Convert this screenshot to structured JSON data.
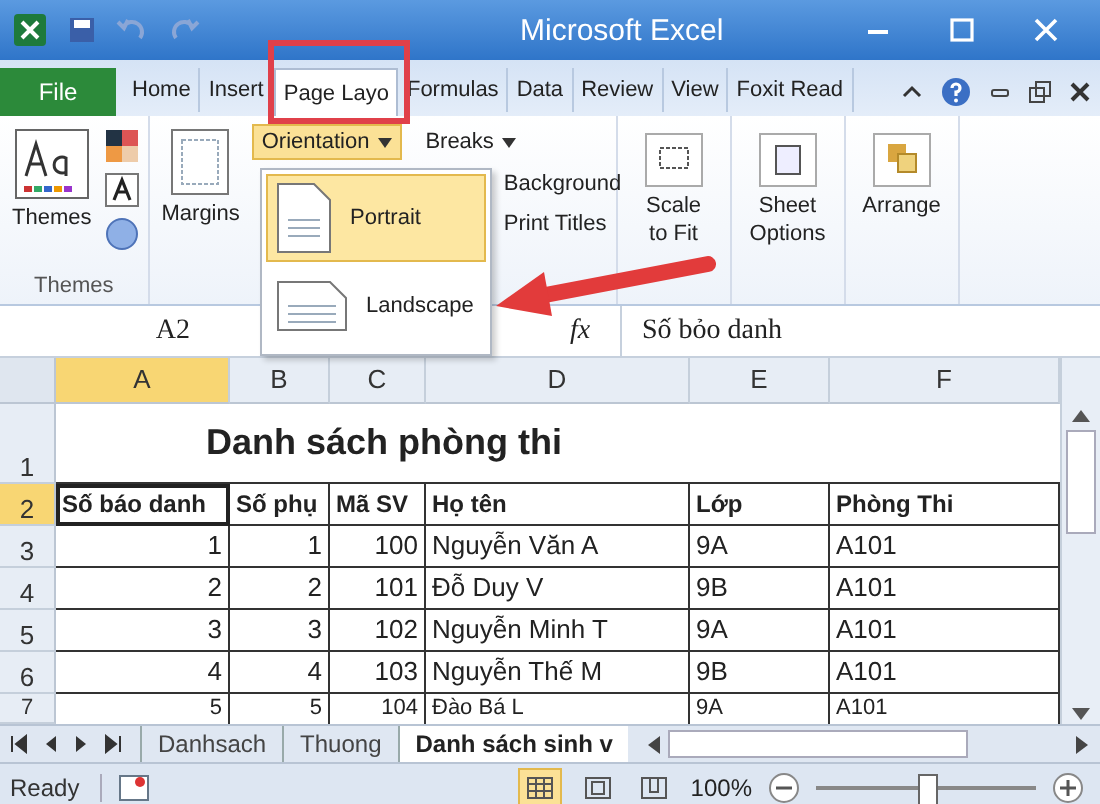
{
  "window": {
    "title": "Microsoft Excel"
  },
  "ribbon_tabs": [
    {
      "label": "File",
      "kind": "file",
      "selected": false
    },
    {
      "label": "Home",
      "kind": "tab",
      "selected": false
    },
    {
      "label": "Insert",
      "kind": "tab",
      "selected": false
    },
    {
      "label": "Page Layo",
      "kind": "tab",
      "selected": true
    },
    {
      "label": "Formulas",
      "kind": "tab",
      "selected": false
    },
    {
      "label": "Data",
      "kind": "tab",
      "selected": false
    },
    {
      "label": "Review",
      "kind": "tab",
      "selected": false
    },
    {
      "label": "View",
      "kind": "tab",
      "selected": false
    },
    {
      "label": "Foxit Read",
      "kind": "tab",
      "selected": false
    }
  ],
  "ribbon": {
    "themes": "Themes",
    "themes_group_label": "Themes",
    "margins": "Margins",
    "orientation": "Orientation",
    "breaks": "Breaks",
    "background": "Background",
    "print_titles": "Print Titles",
    "scale_to_fit": [
      "Scale",
      "to Fit"
    ],
    "sheet_options": [
      "Sheet",
      "Options"
    ],
    "arrange": "Arrange"
  },
  "orientation_menu": [
    {
      "label": "Portrait",
      "kind": "portrait",
      "selected": true
    },
    {
      "label": "Landscape",
      "kind": "landscape",
      "selected": false
    }
  ],
  "formula_bar": {
    "name_box": "A2",
    "fx": "fx",
    "value": "Số bỏo danh"
  },
  "sheet": {
    "columns": [
      {
        "label": "A",
        "selected": true
      },
      {
        "label": "B",
        "selected": false
      },
      {
        "label": "C",
        "selected": false
      },
      {
        "label": "D",
        "selected": false
      },
      {
        "label": "E",
        "selected": false
      },
      {
        "label": "F",
        "selected": false
      }
    ],
    "rows": [
      {
        "number": "1",
        "kind": "title",
        "selected": false,
        "cells": [
          "Danh sách phòng thi"
        ]
      },
      {
        "number": "2",
        "kind": "header",
        "selected": true,
        "cells": [
          "Số báo danh",
          "Số phụ",
          "Mã SV",
          "Họ tên",
          "Lớp",
          "Phòng Thi"
        ]
      },
      {
        "number": "3",
        "kind": "data",
        "selected": false,
        "cells": [
          "1",
          "1",
          "100",
          "Nguyễn Văn A",
          "9A",
          "A101"
        ]
      },
      {
        "number": "4",
        "kind": "data",
        "selected": false,
        "cells": [
          "2",
          "2",
          "101",
          "Đỗ Duy V",
          "9B",
          "A101"
        ]
      },
      {
        "number": "5",
        "kind": "data",
        "selected": false,
        "cells": [
          "3",
          "3",
          "102",
          "Nguyễn Minh T",
          "9A",
          "A101"
        ]
      },
      {
        "number": "6",
        "kind": "data",
        "selected": false,
        "cells": [
          "4",
          "4",
          "103",
          "Nguyễn Thế M",
          "9B",
          "A101"
        ]
      },
      {
        "number": "7",
        "kind": "partial",
        "selected": false,
        "cells": [
          "5",
          "5",
          "104",
          "Đào Bá L",
          "9A",
          "A101"
        ]
      }
    ]
  },
  "sheet_tabs": [
    {
      "label": "Danhsach",
      "selected": false
    },
    {
      "label": "Thuong",
      "selected": false
    },
    {
      "label": "Danh sách sinh v",
      "selected": true
    }
  ],
  "status_bar": {
    "text": "Ready",
    "views": [
      {
        "kind": "normal",
        "selected": true
      },
      {
        "kind": "page_layout",
        "selected": false
      },
      {
        "kind": "page_break",
        "selected": false
      }
    ],
    "zoom": "100%",
    "level": 0.5
  }
}
